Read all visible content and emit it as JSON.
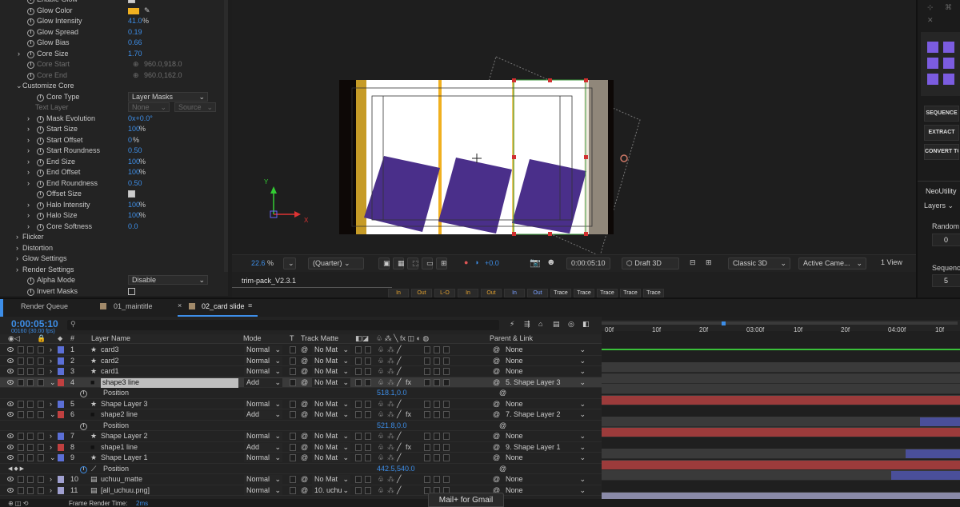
{
  "effects": {
    "rows": [
      {
        "name": "Enable Glow",
        "check": true,
        "indent": 34
      },
      {
        "name": "Glow Color",
        "color": "#f0b020",
        "indent": 34
      },
      {
        "name": "Glow Intensity",
        "value": "41.0",
        "unit": "%",
        "indent": 34
      },
      {
        "name": "Glow Spread",
        "value": "0.19",
        "indent": 34
      },
      {
        "name": "Glow Bias",
        "value": "0.66",
        "indent": 34
      },
      {
        "name": "Core Size",
        "value": "1.70",
        "indent": 34,
        "tri": true
      },
      {
        "name": "Core Start",
        "value": "960.0,918.0",
        "indent": 34,
        "disabled": true
      },
      {
        "name": "Core End",
        "value": "960.0,162.0",
        "indent": 34,
        "disabled": true
      },
      {
        "name": "Customize Core",
        "indent": 22,
        "group": true,
        "open": true
      },
      {
        "name": "Core Type",
        "dropdown": "Layer Masks",
        "indent": 46
      },
      {
        "name": "Text Layer",
        "dropdown2": [
          "None",
          "Source"
        ],
        "indent": 44,
        "disabled": true,
        "noicon": true
      },
      {
        "name": "Mask Evolution",
        "value": "0x+0.0°",
        "indent": 46,
        "tri": true
      },
      {
        "name": "Start Size",
        "value": "100",
        "unit": "%",
        "indent": 46,
        "tri": true
      },
      {
        "name": "Start Offset",
        "value": "0",
        "unit": "%",
        "indent": 46,
        "tri": true
      },
      {
        "name": "Start Roundness",
        "value": "0.50",
        "indent": 46,
        "tri": true
      },
      {
        "name": "End Size",
        "value": "100",
        "unit": "%",
        "indent": 46,
        "tri": true
      },
      {
        "name": "End Offset",
        "value": "100",
        "unit": "%",
        "indent": 46,
        "tri": true
      },
      {
        "name": "End Roundness",
        "value": "0.50",
        "indent": 46,
        "tri": true
      },
      {
        "name": "Offset Size",
        "check": true,
        "indent": 46
      },
      {
        "name": "Halo Intensity",
        "value": "100",
        "unit": "%",
        "indent": 46,
        "tri": true
      },
      {
        "name": "Halo Size",
        "value": "100",
        "unit": "%",
        "indent": 46,
        "tri": true
      },
      {
        "name": "Core Softness",
        "value": "0.0",
        "indent": 46,
        "tri": true
      },
      {
        "name": "Flicker",
        "indent": 22,
        "group": true
      },
      {
        "name": "Distortion",
        "indent": 22,
        "group": true
      },
      {
        "name": "Glow Settings",
        "indent": 22,
        "group": true
      },
      {
        "name": "Render Settings",
        "indent": 22,
        "group": true
      },
      {
        "name": "Alpha Mode",
        "dropdown": "Disable",
        "indent": 34
      },
      {
        "name": "Invert Masks",
        "check": false,
        "indent": 34
      }
    ]
  },
  "viewer": {
    "zoom": "22.6",
    "zoom_unit": "%",
    "resolution": "(Quarter)",
    "exposure": "+0.0",
    "timecode": "0:00:05:10",
    "renderer_draft": "Draft 3D",
    "renderer": "Classic 3D",
    "camera": "Active Came...",
    "view": "1 View"
  },
  "trim": {
    "title": "trim-pack_V2.3.1",
    "buttons": [
      "In",
      "Out",
      "L-O",
      "In",
      "Out",
      "In",
      "Out",
      "Trace",
      "Trace",
      "Trace",
      "Trace",
      "Trace"
    ]
  },
  "right": {
    "buttons": [
      "SEQUENCE",
      "EXTRACT",
      "CONVERT TO"
    ],
    "title": "NeoUtility",
    "layers_label": "Layers",
    "random_label": "Random",
    "random_value": "0",
    "sequence_label": "Sequence",
    "sequence_value": "5"
  },
  "timeline": {
    "tabs": [
      "Render Queue",
      "01_maintitle",
      "02_card slide"
    ],
    "timecode": "0:00:05:10",
    "fps": "00160 (30.00 fps)",
    "cols": {
      "num": "#",
      "layer": "Layer Name",
      "mode": "Mode",
      "t": "T",
      "matte": "Track Matte",
      "parent": "Parent & Link"
    },
    "ruler": [
      "00f",
      "10f",
      "20f",
      "03:00f",
      "10f",
      "20f",
      "04:00f",
      "10f"
    ],
    "layers": [
      {
        "num": "1",
        "name": "card3",
        "type": "star",
        "color": "#5b6fd6",
        "mode": "Normal",
        "matte": "No Mat",
        "parent": "None"
      },
      {
        "num": "2",
        "name": "card2",
        "type": "star",
        "color": "#5b6fd6",
        "mode": "Normal",
        "matte": "No Mat",
        "parent": "None"
      },
      {
        "num": "3",
        "name": "card1",
        "type": "star",
        "color": "#5b6fd6",
        "mode": "Normal",
        "matte": "No Mat",
        "parent": "None"
      },
      {
        "num": "4",
        "name": "shape3 line",
        "type": "solid",
        "color": "#c04040",
        "mode": "Add",
        "matte": "No Mat",
        "parent": "5. Shape Layer 3",
        "selected": true,
        "open": true
      },
      {
        "prop": "Position",
        "value": "518.1,0.0"
      },
      {
        "num": "5",
        "name": "Shape Layer 3",
        "type": "star",
        "color": "#5b6fd6",
        "mode": "Normal",
        "matte": "No Mat",
        "parent": "None"
      },
      {
        "num": "6",
        "name": "shape2 line",
        "type": "solid",
        "color": "#c04040",
        "mode": "Add",
        "matte": "No Mat",
        "parent": "7. Shape Layer 2",
        "open": true
      },
      {
        "prop": "Position",
        "value": "521.8,0.0"
      },
      {
        "num": "7",
        "name": "Shape Layer 2",
        "type": "star",
        "color": "#5b6fd6",
        "mode": "Normal",
        "matte": "No Mat",
        "parent": "None"
      },
      {
        "num": "8",
        "name": "shape1 line",
        "type": "solid",
        "color": "#c04040",
        "mode": "Add",
        "matte": "No Mat",
        "parent": "9. Shape Layer 1"
      },
      {
        "num": "9",
        "name": "Shape Layer 1",
        "type": "star",
        "color": "#5b6fd6",
        "mode": "Normal",
        "matte": "No Mat",
        "parent": "None",
        "open": true
      },
      {
        "prop": "Position",
        "value": "442.5,540.0",
        "keyed": true
      },
      {
        "num": "10",
        "name": "uchuu_matte",
        "type": "file",
        "color": "#a0a0d0",
        "mode": "Normal",
        "matte": "No Mat",
        "parent": "None"
      },
      {
        "num": "11",
        "name": "[all_uchuu.png]",
        "type": "file",
        "color": "#a0a0d0",
        "mode": "Normal",
        "matte": "10. uchu",
        "parent": "None"
      }
    ],
    "status": "Frame Render Time:",
    "status_value": "2ms"
  },
  "gmail": "Mail+ for Gmail",
  "colors": {
    "accent": "#3d8ee8",
    "purple": "#4a2f8a",
    "glow": "#f0b020"
  }
}
